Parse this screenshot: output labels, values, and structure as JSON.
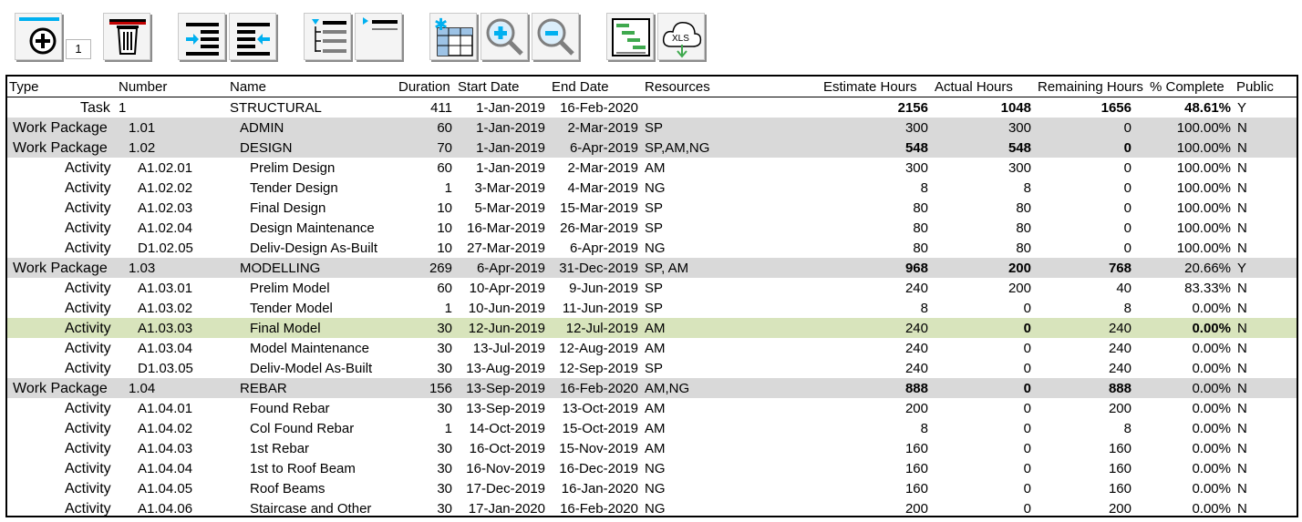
{
  "toolbar": {
    "buttons": [
      {
        "name": "add-row-button",
        "icon": "add-row-icon"
      },
      {
        "name": "delete-row-button",
        "icon": "trash-icon"
      },
      {
        "name": "indent-button",
        "icon": "indent-icon"
      },
      {
        "name": "outdent-button",
        "icon": "outdent-icon"
      },
      {
        "name": "expand-levels-button",
        "icon": "expand-tree-icon"
      },
      {
        "name": "collapse-levels-button",
        "icon": "collapse-tree-icon"
      },
      {
        "name": "freeze-panes-button",
        "icon": "freeze-grid-icon"
      },
      {
        "name": "zoom-in-button",
        "icon": "zoom-in-icon"
      },
      {
        "name": "zoom-out-button",
        "icon": "zoom-out-icon"
      },
      {
        "name": "gantt-view-button",
        "icon": "gantt-chart-icon"
      },
      {
        "name": "export-xls-button",
        "icon": "xls-download-icon"
      }
    ],
    "level_value": "1",
    "xls_label": "XLS"
  },
  "colors": {
    "wp_bg": "#d9d9d9",
    "selected_bg": "#d8e4bc",
    "accent_blue": "#00b0f0",
    "accent_red": "#c00000",
    "accent_green": "#3fa94e"
  },
  "columns": [
    "Type",
    "Number",
    "Name",
    "Duration",
    "Start Date",
    "End Date",
    "Resources",
    "Estimate Hours",
    "Actual Hours",
    "Remaining Hours",
    "% Complete",
    "Public"
  ],
  "rows": [
    {
      "kind": "task",
      "type": "Task",
      "number": "1",
      "name": "STRUCTURAL",
      "duration": "411",
      "start": "1-Jan-2019",
      "end": "16-Feb-2020",
      "resources": "",
      "estimate": "2156",
      "actual": "1048",
      "remaining": "1656",
      "complete": "48.61%",
      "public": "Y",
      "bold": [
        "estimate",
        "actual",
        "remaining",
        "complete"
      ]
    },
    {
      "kind": "wp",
      "type": "Work Package",
      "number": "1.01",
      "name": "ADMIN",
      "duration": "60",
      "start": "1-Jan-2019",
      "end": "2-Mar-2019",
      "resources": "SP",
      "estimate": "300",
      "actual": "300",
      "remaining": "0",
      "complete": "100.00%",
      "public": "N",
      "bold": []
    },
    {
      "kind": "wp",
      "type": "Work Package",
      "number": "1.02",
      "name": "DESIGN",
      "duration": "70",
      "start": "1-Jan-2019",
      "end": "6-Apr-2019",
      "resources": "SP,AM,NG",
      "estimate": "548",
      "actual": "548",
      "remaining": "0",
      "complete": "100.00%",
      "public": "N",
      "bold": [
        "estimate",
        "actual",
        "remaining"
      ]
    },
    {
      "kind": "act",
      "type": "Activity",
      "number": "A1.02.01",
      "name": "Prelim Design",
      "duration": "60",
      "start": "1-Jan-2019",
      "end": "2-Mar-2019",
      "resources": "AM",
      "estimate": "300",
      "actual": "300",
      "remaining": "0",
      "complete": "100.00%",
      "public": "N",
      "bold": []
    },
    {
      "kind": "act",
      "type": "Activity",
      "number": "A1.02.02",
      "name": "Tender Design",
      "duration": "1",
      "start": "3-Mar-2019",
      "end": "4-Mar-2019",
      "resources": "NG",
      "estimate": "8",
      "actual": "8",
      "remaining": "0",
      "complete": "100.00%",
      "public": "N",
      "bold": []
    },
    {
      "kind": "act",
      "type": "Activity",
      "number": "A1.02.03",
      "name": "Final Design",
      "duration": "10",
      "start": "5-Mar-2019",
      "end": "15-Mar-2019",
      "resources": "SP",
      "estimate": "80",
      "actual": "80",
      "remaining": "0",
      "complete": "100.00%",
      "public": "N",
      "bold": []
    },
    {
      "kind": "act",
      "type": "Activity",
      "number": "A1.02.04",
      "name": "Design Maintenance",
      "duration": "10",
      "start": "16-Mar-2019",
      "end": "26-Mar-2019",
      "resources": "SP",
      "estimate": "80",
      "actual": "80",
      "remaining": "0",
      "complete": "100.00%",
      "public": "N",
      "bold": []
    },
    {
      "kind": "act",
      "type": "Activity",
      "number": "D1.02.05",
      "name": "Deliv-Design As-Built",
      "duration": "10",
      "start": "27-Mar-2019",
      "end": "6-Apr-2019",
      "resources": "NG",
      "estimate": "80",
      "actual": "80",
      "remaining": "0",
      "complete": "100.00%",
      "public": "N",
      "bold": []
    },
    {
      "kind": "wp",
      "type": "Work Package",
      "number": "1.03",
      "name": "MODELLING",
      "duration": "269",
      "start": "6-Apr-2019",
      "end": "31-Dec-2019",
      "resources": "SP, AM",
      "estimate": "968",
      "actual": "200",
      "remaining": "768",
      "complete": "20.66%",
      "public": "Y",
      "bold": [
        "estimate",
        "actual",
        "remaining"
      ]
    },
    {
      "kind": "act",
      "type": "Activity",
      "number": "A1.03.01",
      "name": "Prelim Model",
      "duration": "60",
      "start": "10-Apr-2019",
      "end": "9-Jun-2019",
      "resources": "SP",
      "estimate": "240",
      "actual": "200",
      "remaining": "40",
      "complete": "83.33%",
      "public": "N",
      "bold": []
    },
    {
      "kind": "act",
      "type": "Activity",
      "number": "A1.03.02",
      "name": "Tender Model",
      "duration": "1",
      "start": "10-Jun-2019",
      "end": "11-Jun-2019",
      "resources": "SP",
      "estimate": "8",
      "actual": "0",
      "remaining": "8",
      "complete": "0.00%",
      "public": "N",
      "bold": []
    },
    {
      "kind": "sel",
      "type": "Activity",
      "number": "A1.03.03",
      "name": "Final Model",
      "duration": "30",
      "start": "12-Jun-2019",
      "end": "12-Jul-2019",
      "resources": "AM",
      "estimate": "240",
      "actual": "0",
      "remaining": "240",
      "complete": "0.00%",
      "public": "N",
      "bold": [
        "actual",
        "complete"
      ]
    },
    {
      "kind": "act",
      "type": "Activity",
      "number": "A1.03.04",
      "name": "Model Maintenance",
      "duration": "30",
      "start": "13-Jul-2019",
      "end": "12-Aug-2019",
      "resources": "AM",
      "estimate": "240",
      "actual": "0",
      "remaining": "240",
      "complete": "0.00%",
      "public": "N",
      "bold": []
    },
    {
      "kind": "act",
      "type": "Activity",
      "number": "D1.03.05",
      "name": "Deliv-Model As-Built",
      "duration": "30",
      "start": "13-Aug-2019",
      "end": "12-Sep-2019",
      "resources": "SP",
      "estimate": "240",
      "actual": "0",
      "remaining": "240",
      "complete": "0.00%",
      "public": "N",
      "bold": []
    },
    {
      "kind": "wp",
      "type": "Work Package",
      "number": "1.04",
      "name": "REBAR",
      "duration": "156",
      "start": "13-Sep-2019",
      "end": "16-Feb-2020",
      "resources": "AM,NG",
      "estimate": "888",
      "actual": "0",
      "remaining": "888",
      "complete": "0.00%",
      "public": "N",
      "bold": [
        "estimate",
        "actual",
        "remaining"
      ]
    },
    {
      "kind": "act",
      "type": "Activity",
      "number": "A1.04.01",
      "name": "Found Rebar",
      "duration": "30",
      "start": "13-Sep-2019",
      "end": "13-Oct-2019",
      "resources": "AM",
      "estimate": "200",
      "actual": "0",
      "remaining": "200",
      "complete": "0.00%",
      "public": "N",
      "bold": []
    },
    {
      "kind": "act",
      "type": "Activity",
      "number": "A1.04.02",
      "name": "Col Found Rebar",
      "duration": "1",
      "start": "14-Oct-2019",
      "end": "15-Oct-2019",
      "resources": "AM",
      "estimate": "8",
      "actual": "0",
      "remaining": "8",
      "complete": "0.00%",
      "public": "N",
      "bold": []
    },
    {
      "kind": "act",
      "type": "Activity",
      "number": "A1.04.03",
      "name": "1st Rebar",
      "duration": "30",
      "start": "16-Oct-2019",
      "end": "15-Nov-2019",
      "resources": "AM",
      "estimate": "160",
      "actual": "0",
      "remaining": "160",
      "complete": "0.00%",
      "public": "N",
      "bold": []
    },
    {
      "kind": "act",
      "type": "Activity",
      "number": "A1.04.04",
      "name": "1st to Roof Beam",
      "duration": "30",
      "start": "16-Nov-2019",
      "end": "16-Dec-2019",
      "resources": "NG",
      "estimate": "160",
      "actual": "0",
      "remaining": "160",
      "complete": "0.00%",
      "public": "N",
      "bold": []
    },
    {
      "kind": "act",
      "type": "Activity",
      "number": "A1.04.05",
      "name": "Roof Beams",
      "duration": "30",
      "start": "17-Dec-2019",
      "end": "16-Jan-2020",
      "resources": "NG",
      "estimate": "160",
      "actual": "0",
      "remaining": "160",
      "complete": "0.00%",
      "public": "N",
      "bold": []
    },
    {
      "kind": "act",
      "type": "Activity",
      "number": "A1.04.06",
      "name": "Staircase and Other",
      "duration": "30",
      "start": "17-Jan-2020",
      "end": "16-Feb-2020",
      "resources": "NG",
      "estimate": "200",
      "actual": "0",
      "remaining": "200",
      "complete": "0.00%",
      "public": "N",
      "bold": []
    }
  ]
}
